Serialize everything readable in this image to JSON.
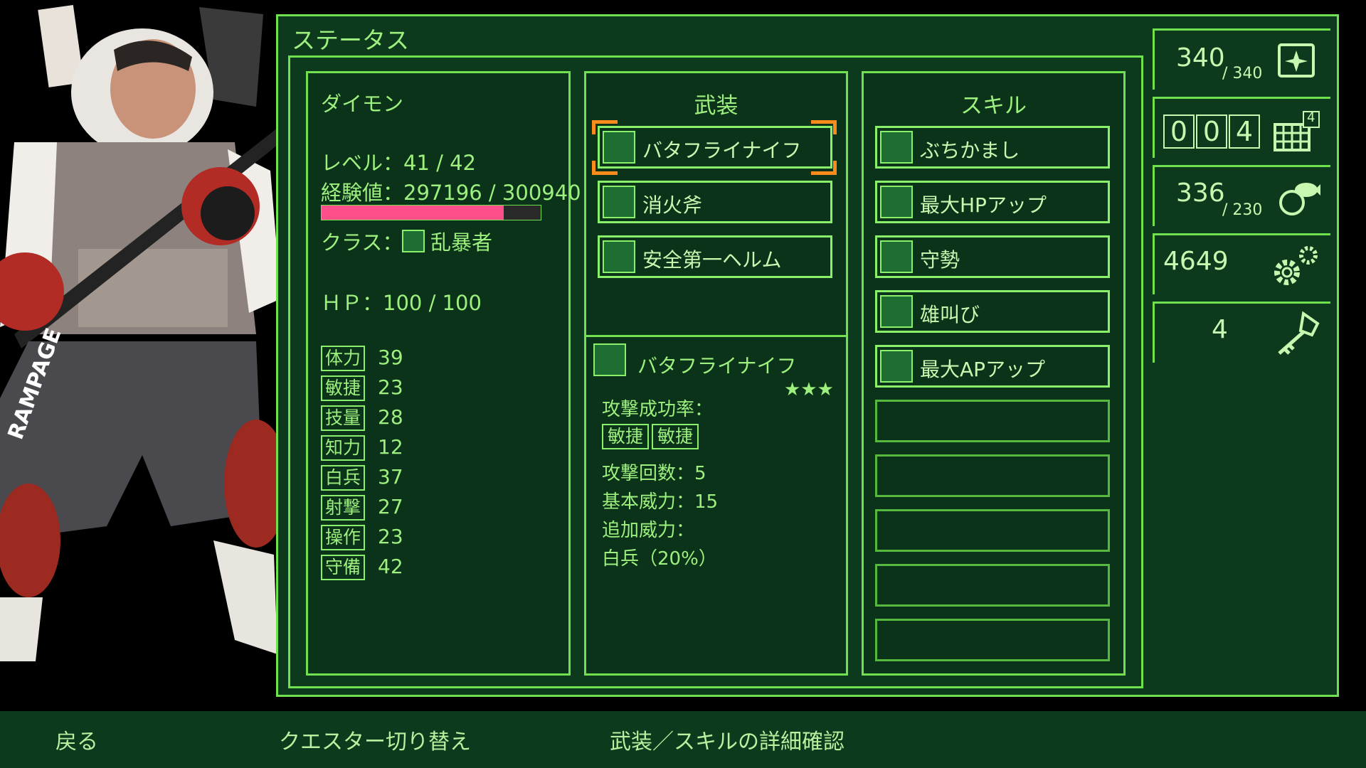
{
  "window": {
    "title": "ステータス"
  },
  "character": {
    "name": "ダイモン",
    "level": "レベル：41 / 42",
    "exp": "経験値：297196 / 300940",
    "exp_ratio": 0.83,
    "class_label": "クラス：",
    "class_name": "乱暴者",
    "hp": "ＨＰ：100 / 100",
    "stats": [
      {
        "label": "体力",
        "value": "39"
      },
      {
        "label": "敏捷",
        "value": "23"
      },
      {
        "label": "技量",
        "value": "28"
      },
      {
        "label": "知力",
        "value": "12"
      },
      {
        "label": "白兵",
        "value": "37"
      },
      {
        "label": "射撃",
        "value": "27"
      },
      {
        "label": "操作",
        "value": "23"
      },
      {
        "label": "守備",
        "value": "42"
      }
    ]
  },
  "equipment": {
    "header": "武装",
    "items": [
      {
        "label": "バタフライナイフ",
        "icon": "knife-icon"
      },
      {
        "label": "消火斧",
        "icon": "axe-icon"
      },
      {
        "label": "安全第一ヘルム",
        "icon": "helmet-icon"
      }
    ],
    "detail": {
      "name": "バタフライナイフ",
      "stars": "★★★",
      "success_label": "攻撃成功率：",
      "success_tags": [
        "敏捷",
        "敏捷"
      ],
      "attacks": "攻撃回数：5",
      "base_power": "基本威力：15",
      "extra_label": "追加威力：",
      "extra_value": "白兵（20%）"
    }
  },
  "skills": {
    "header": "スキル",
    "items": [
      {
        "label": "ぶちかまし",
        "icon": "triangle-icon"
      },
      {
        "label": "最大HPアップ",
        "icon": "hexagon-icon"
      },
      {
        "label": "守勢",
        "icon": "hexagon-icon"
      },
      {
        "label": "雄叫び",
        "icon": "triangle-icon"
      },
      {
        "label": "最大APアップ",
        "icon": "hexagon-icon"
      }
    ],
    "empty_slots": 5
  },
  "side": {
    "ap_value": "340",
    "ap_max": "/ 340",
    "day_digits": [
      "0",
      "0",
      "4"
    ],
    "day_badge": "4",
    "food_value": "336",
    "food_max": "/ 230",
    "parts": "4649",
    "keys": "4"
  },
  "bottom": {
    "back": "戻る",
    "switch": "クエスター切り替え",
    "detail": "武装／スキルの詳細確認"
  },
  "colors": {
    "accent": "#6fe04e",
    "panel": "#0d3a1c",
    "exp_bar": "#ff4f8a",
    "cursor": "#ff8c1a"
  }
}
